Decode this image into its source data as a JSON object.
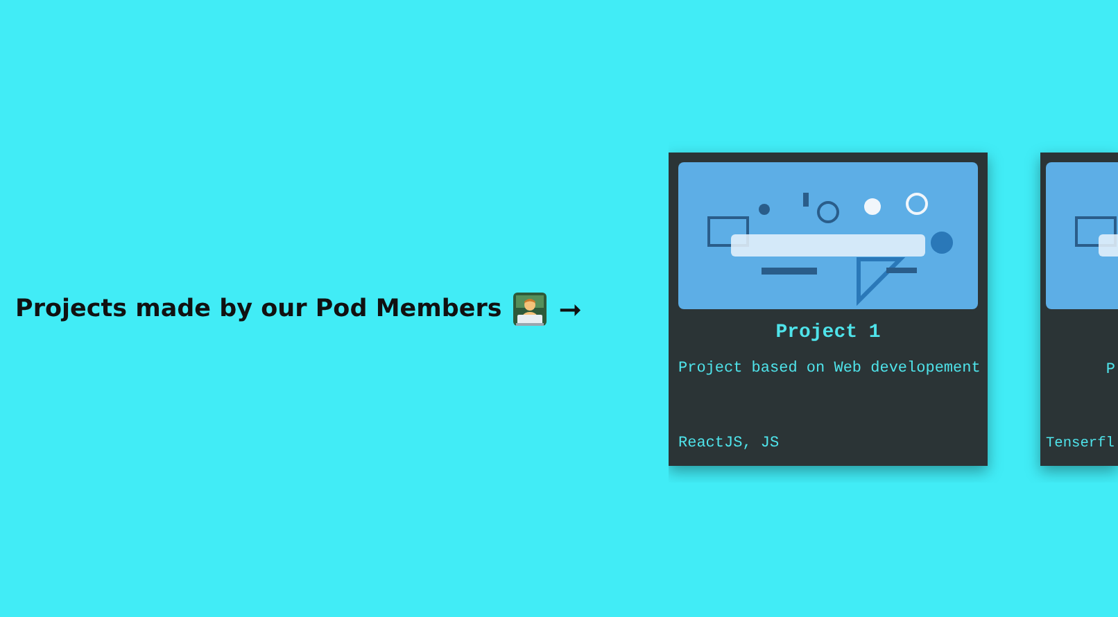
{
  "heading": {
    "text": "Projects made by our Pod Members",
    "arrow": "➞"
  },
  "projects": [
    {
      "title": "Project 1",
      "description": "Project based on Web developement",
      "tags": "ReactJS, JS"
    },
    {
      "description": "P",
      "tags": "Tenserfl"
    }
  ]
}
